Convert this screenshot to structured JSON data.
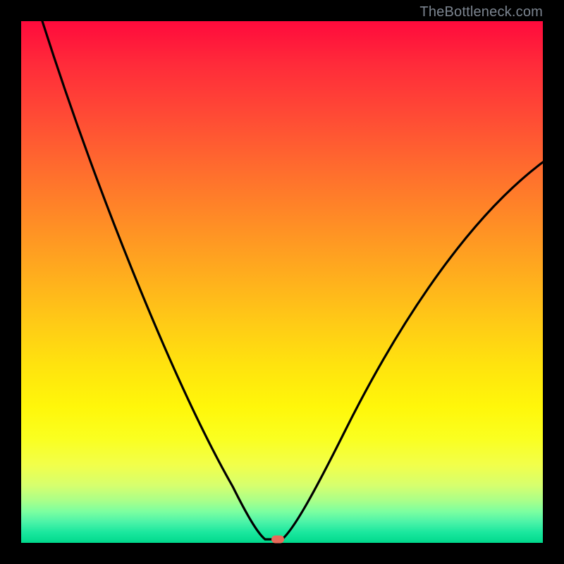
{
  "watermark": "TheBottleneck.com",
  "colors": {
    "frame": "#000000",
    "curve": "#000000",
    "marker": "#e86a5a",
    "watermark_text": "#7c8590",
    "gradient_top": "#ff0a3c",
    "gradient_bottom": "#00d98c"
  },
  "chart_data": {
    "type": "line",
    "title": "",
    "xlabel": "",
    "ylabel": "",
    "xlim": [
      0,
      100
    ],
    "ylim": [
      0,
      100
    ],
    "grid": false,
    "legend": false,
    "series": [
      {
        "name": "bottleneck-curve-left",
        "x": [
          0,
          5,
          10,
          15,
          20,
          25,
          30,
          35,
          40,
          43,
          45,
          47
        ],
        "y": [
          100,
          86,
          73,
          61,
          50,
          40,
          31,
          22,
          13,
          6,
          2,
          0
        ]
      },
      {
        "name": "bottleneck-curve-right",
        "x": [
          50,
          55,
          60,
          65,
          70,
          75,
          80,
          85,
          90,
          95,
          100
        ],
        "y": [
          0,
          6,
          13,
          21,
          29,
          37,
          45,
          53,
          60,
          67,
          73
        ]
      }
    ],
    "minimum_marker": {
      "x": 49,
      "y": 0
    },
    "annotations": []
  }
}
